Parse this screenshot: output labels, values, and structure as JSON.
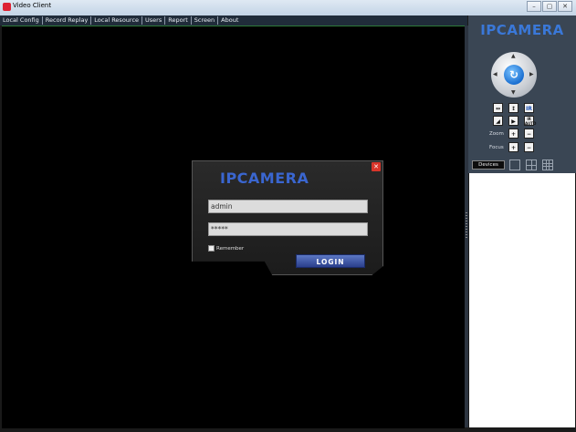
{
  "window": {
    "title": "Video Client",
    "buttons": [
      "–",
      "▢",
      "✕"
    ]
  },
  "menu": [
    "Local Config",
    "Record Replay",
    "Local Resource",
    "Users",
    "Report",
    "Screen",
    "About"
  ],
  "brand": "IPCAMERA",
  "ptz": {
    "controls_row1": [
      "↔",
      "↕",
      "IR"
    ],
    "controls_row2": [
      "◢",
      "▶",
      "IR AUTO"
    ],
    "zoom_label": "Zoom",
    "focus_label": "Focus",
    "zoom_in": "+",
    "zoom_out": "−"
  },
  "devices_tab": "Devices",
  "login": {
    "brand": "IPCAMERA",
    "username": "admin",
    "password": "*****",
    "remember_label": "Remember",
    "login_button": "LOGIN",
    "close": "✕"
  },
  "colors": {
    "accent": "#3a78d8",
    "close": "#d9352a",
    "panel": "#3a4654"
  }
}
